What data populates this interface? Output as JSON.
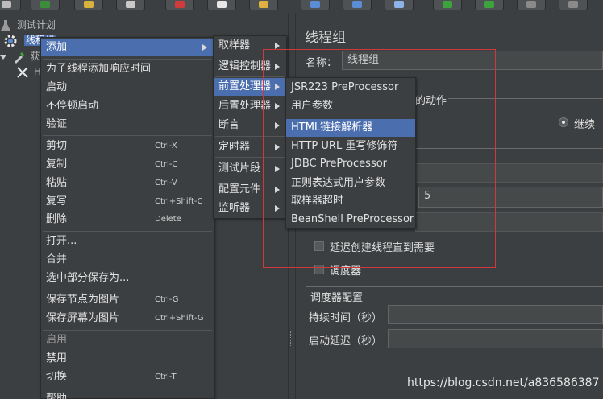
{
  "toolbar": {
    "buttons": [
      {
        "icon": "new-icon",
        "color": "#bbbbbb"
      },
      {
        "icon": "templates-icon",
        "color": "#3a8e3a"
      },
      {
        "icon": "open-icon",
        "color": "#d7b23c"
      },
      {
        "icon": "save-icon",
        "color": "#c9c9c9"
      },
      {
        "icon": "cut-icon",
        "color": "#d23b3b"
      },
      {
        "icon": "copy-icon",
        "color": "#e8e8e8"
      },
      {
        "icon": "paste-icon",
        "color": "#e0b040"
      },
      {
        "icon": "expand-icon",
        "color": "#5b8dd6"
      },
      {
        "icon": "collapse-icon",
        "color": "#5b8dd6"
      },
      {
        "icon": "toggle-icon",
        "color": "#8db4e8"
      },
      {
        "icon": "start-icon",
        "color": "#3da33d"
      },
      {
        "icon": "start-no-pause-icon",
        "color": "#3da33d"
      },
      {
        "icon": "stop-icon",
        "color": "#8a8a8a"
      },
      {
        "icon": "shutdown-icon",
        "color": "#8a8a8a"
      }
    ]
  },
  "tree": {
    "test_plan": "测试计划",
    "thread_group": "线程组",
    "item3": "获",
    "item4": "H"
  },
  "context_menu": {
    "add": "添加",
    "add_think_time": "为子线程添加响应时间",
    "start": "启动",
    "start_no_pause": "不停顿启动",
    "validate": "验证",
    "cut": {
      "label": "剪切",
      "shortcut": "Ctrl-X"
    },
    "copy": {
      "label": "复制",
      "shortcut": "Ctrl-C"
    },
    "paste": {
      "label": "粘贴",
      "shortcut": "Ctrl-V"
    },
    "duplicate": {
      "label": "复写",
      "shortcut": "Ctrl+Shift-C"
    },
    "remove": {
      "label": "删除",
      "shortcut": "Delete"
    },
    "open": "打开...",
    "merge": "合并",
    "save_selection": "选中部分保存为...",
    "save_node_image": {
      "label": "保存节点为图片",
      "shortcut": "Ctrl-G"
    },
    "save_screen_image": {
      "label": "保存屏幕为图片",
      "shortcut": "Ctrl+Shift-G"
    },
    "enable": "启用",
    "disable": "禁用",
    "toggle": {
      "label": "切换",
      "shortcut": "Ctrl-T"
    },
    "help": "帮助"
  },
  "add_submenu": {
    "items": [
      "取样器",
      "逻辑控制器",
      "前置处理器",
      "后置处理器",
      "断言",
      "定时器",
      "测试片段",
      "配置元件",
      "监听器"
    ]
  },
  "preprocessor_submenu": {
    "items": [
      "JSR223 PreProcessor",
      "用户参数",
      "HTML链接解析器",
      "HTTP URL 重写修饰符",
      "JDBC PreProcessor",
      "正则表达式用户参数",
      "取样器超时",
      "BeanShell PreProcessor"
    ]
  },
  "panel": {
    "title": "线程组",
    "name_label": "名称：",
    "name_value": "线程组",
    "action_section": "的动作",
    "continue_label": "继续",
    "loop_value": "5",
    "delay_thread_creation": "延迟创建线程直到需要",
    "scheduler": "调度器",
    "scheduler_config": "调度器配置",
    "duration_label": "持续时间（秒）",
    "startup_delay_label": "启动延迟（秒）"
  },
  "watermark": "https://blog.csdn.net/a836586387",
  "colors": {
    "background": "#3c3f41",
    "selection": "#4b6eaf",
    "highlight_box": "#d0383b"
  }
}
